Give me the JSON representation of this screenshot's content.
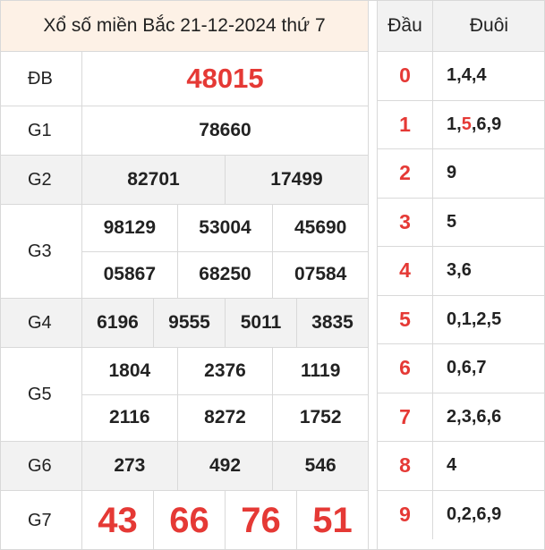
{
  "title": "Xổ số miền Bắc 21-12-2024 thứ 7",
  "accent_color": "#e53935",
  "prizes": {
    "db": {
      "label": "ĐB",
      "numbers": [
        "48015"
      ]
    },
    "g1": {
      "label": "G1",
      "numbers": [
        "78660"
      ]
    },
    "g2": {
      "label": "G2",
      "numbers": [
        "82701",
        "17499"
      ]
    },
    "g3": {
      "label": "G3",
      "numbers": [
        "98129",
        "53004",
        "45690",
        "05867",
        "68250",
        "07584"
      ]
    },
    "g4": {
      "label": "G4",
      "numbers": [
        "6196",
        "9555",
        "5011",
        "3835"
      ]
    },
    "g5": {
      "label": "G5",
      "numbers": [
        "1804",
        "2376",
        "1119",
        "2116",
        "8272",
        "1752"
      ]
    },
    "g6": {
      "label": "G6",
      "numbers": [
        "273",
        "492",
        "546"
      ]
    },
    "g7": {
      "label": "G7",
      "numbers": [
        "43",
        "66",
        "76",
        "51"
      ]
    }
  },
  "loto": {
    "head_label": "Đầu",
    "tail_label": "Đuôi",
    "rows": [
      {
        "head": "0",
        "tails": [
          "1",
          "4",
          "4"
        ]
      },
      {
        "head": "1",
        "tails": [
          "1",
          "5",
          "6",
          "9"
        ],
        "highlight": 1
      },
      {
        "head": "2",
        "tails": [
          "9"
        ]
      },
      {
        "head": "3",
        "tails": [
          "5"
        ]
      },
      {
        "head": "4",
        "tails": [
          "3",
          "6"
        ]
      },
      {
        "head": "5",
        "tails": [
          "0",
          "1",
          "2",
          "5"
        ]
      },
      {
        "head": "6",
        "tails": [
          "0",
          "6",
          "7"
        ]
      },
      {
        "head": "7",
        "tails": [
          "2",
          "3",
          "6",
          "6"
        ]
      },
      {
        "head": "8",
        "tails": [
          "4"
        ]
      },
      {
        "head": "9",
        "tails": [
          "0",
          "2",
          "6",
          "9"
        ]
      }
    ]
  }
}
